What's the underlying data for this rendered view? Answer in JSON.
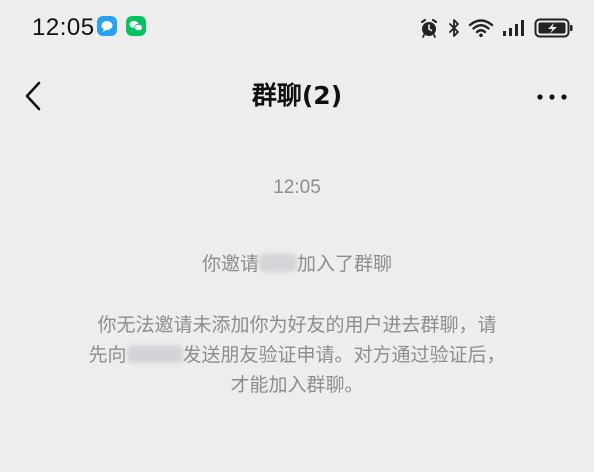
{
  "status_bar": {
    "time": "12:05",
    "left_icons": [
      "qq-notification-icon",
      "wechat-notification-icon"
    ],
    "right_icons": [
      "alarm-icon",
      "bluetooth-icon",
      "wifi-icon",
      "cellular-signal-icon",
      "battery-charging-icon"
    ],
    "colors": {
      "qq_blue": "#2aa0f5",
      "wechat_green": "#08c160"
    }
  },
  "nav": {
    "back_icon": "chevron-left-icon",
    "title": "群聊(2)",
    "more_icon": "ellipsis-icon"
  },
  "chat": {
    "timestamp": "12:05",
    "invite_message": {
      "prefix": "你邀请",
      "suffix": "加入了群聊"
    },
    "notice_message": {
      "line1": "你无法邀请未添加你为好友的用户进去群聊，请",
      "line2_prefix": "先向",
      "line2_suffix": "发送朋友验证申请。对方通过验证后，",
      "line3": "才能加入群聊。"
    }
  },
  "theme": {
    "background": "#ededed",
    "system_text": "#8d8d8d"
  }
}
